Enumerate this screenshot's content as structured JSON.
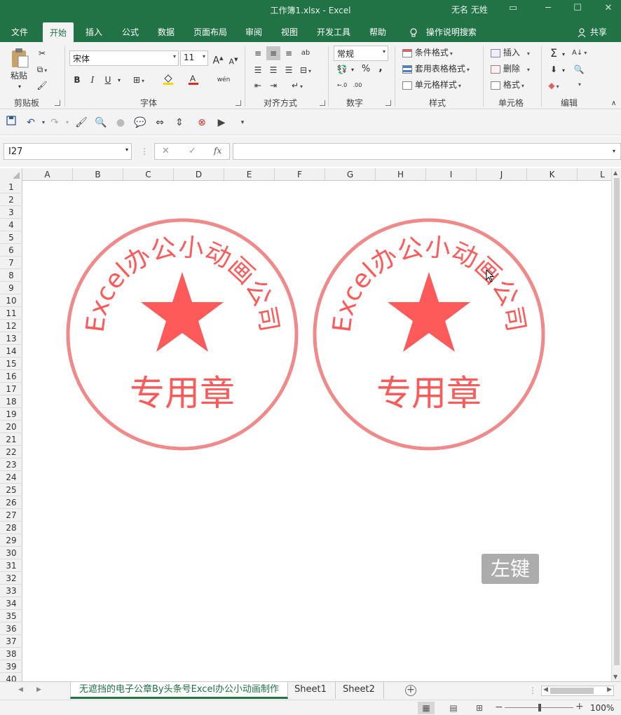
{
  "window": {
    "title": "工作簿1.xlsx  -  Excel",
    "user": "无名 无姓"
  },
  "tabs": [
    {
      "label": "文件"
    },
    {
      "label": "开始",
      "active": true
    },
    {
      "label": "插入"
    },
    {
      "label": "公式"
    },
    {
      "label": "数据"
    },
    {
      "label": "页面布局"
    },
    {
      "label": "审阅"
    },
    {
      "label": "视图"
    },
    {
      "label": "开发工具"
    },
    {
      "label": "帮助"
    }
  ],
  "tell_me": "操作说明搜索",
  "share": "共享",
  "ribbon": {
    "clipboard": {
      "paste": "粘贴",
      "label": "剪贴板"
    },
    "font": {
      "name": "宋体",
      "size": "11",
      "label": "字体",
      "bold": "B",
      "italic": "I",
      "underline": "U",
      "grow": "A",
      "shrink": "A",
      "phonetic": "wén",
      "font_color": "#e0281b",
      "fill_color": "#ffd400"
    },
    "alignment": {
      "label": "对齐方式",
      "orientation": "ab"
    },
    "number": {
      "format": "常规",
      "label": "数字",
      "percent": "%",
      "comma": ","
    },
    "styles": {
      "conditional": "条件格式",
      "table": "套用表格格式",
      "cell": "单元格样式",
      "label": "样式"
    },
    "cells": {
      "insert": "插入",
      "delete": "删除",
      "format": "格式",
      "label": "单元格"
    },
    "editing": {
      "label": "编辑"
    }
  },
  "formula_bar": {
    "name_box": "I27",
    "fx": "fx",
    "formula": ""
  },
  "columns": [
    "A",
    "B",
    "C",
    "D",
    "E",
    "F",
    "G",
    "H",
    "I",
    "J",
    "K",
    "L"
  ],
  "rows": [
    "1",
    "2",
    "3",
    "4",
    "5",
    "6",
    "7",
    "8",
    "9",
    "10",
    "11",
    "12",
    "13",
    "14",
    "15",
    "16",
    "17",
    "18",
    "19",
    "20",
    "21",
    "22",
    "23",
    "24",
    "25",
    "26",
    "27",
    "28",
    "29",
    "30",
    "31",
    "32",
    "33",
    "34",
    "35",
    "36",
    "37",
    "38",
    "39",
    "40"
  ],
  "seals": [
    {
      "arc_text": "Excel办公小动画公司",
      "center_text": "专用章",
      "color": "#ff5a5a",
      "ring_color": "#f08a8a"
    },
    {
      "arc_text": "Excel办公小动画公司",
      "center_text": "专用章",
      "color": "#ff5a5a",
      "ring_color": "#f08a8a"
    }
  ],
  "overlay_hint": "左键",
  "sheets": [
    {
      "name": "无遮挡的电子公章By头条号Excel办公小动画制作",
      "active": true
    },
    {
      "name": "Sheet1"
    },
    {
      "name": "Sheet2"
    }
  ],
  "statusbar": {
    "zoom": "100%"
  },
  "icons": [
    "paste-icon",
    "cut-icon",
    "copy-icon",
    "format-painter-icon",
    "save-icon",
    "undo-icon",
    "redo-icon",
    "lightbulb-icon",
    "person-icon",
    "star-icon",
    "cursor-icon"
  ]
}
